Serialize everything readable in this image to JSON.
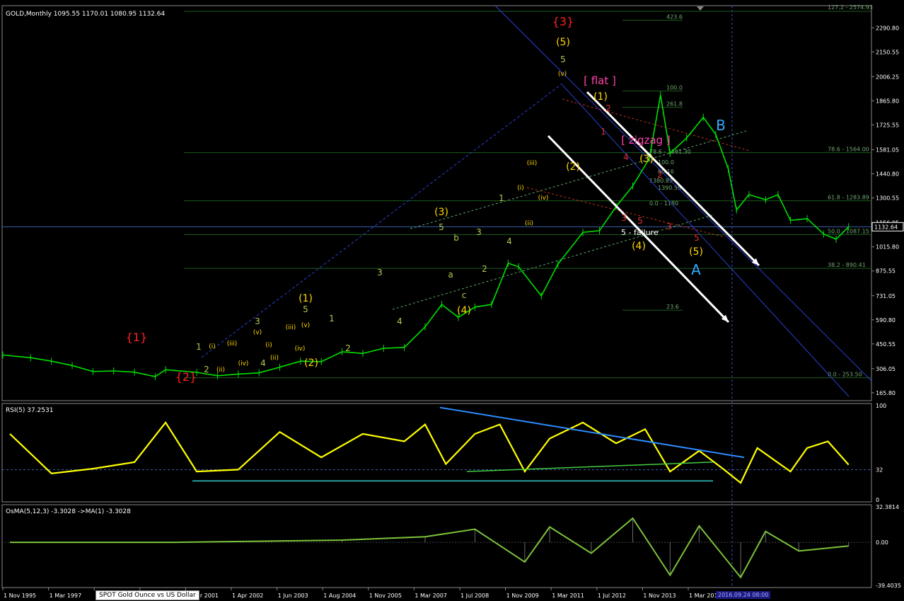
{
  "header": {
    "main": "GOLD,Monthly  1095.55 1170.01 1080.95 1132.64",
    "rsi": "RSI(5) 37.2531",
    "osma": "OsMA(5,12,3) -3.3028  ->MA(1) -3.3028"
  },
  "price_axis": [
    "2290.80",
    "2150.55",
    "2006.25",
    "1865.80",
    "1725.55",
    "1581.05",
    "1440.80",
    "1300.55",
    "1156.05",
    "1015.80",
    "875.55",
    "731.05",
    "590.80",
    "450.55",
    "306.05",
    "165.80"
  ],
  "current_price_label": "1132.64",
  "rsi_axis": [
    "100",
    "32",
    "0"
  ],
  "osma_axis": [
    "32.3814",
    "0.00",
    "-39.4035"
  ],
  "time_axis": [
    "1 Nov 1995",
    "1 Mar 1997",
    "1 Jul 1998",
    "1 Nov 1999",
    "1 Mar 2001",
    "1 Apr 2002",
    "1 Jun 2003",
    "1 Aug 2004",
    "1 Nov 2005",
    "1 Mar 2007",
    "1 Jul 2008",
    "1 Nov 2009",
    "1 Mar 2011",
    "1 Jul 2012",
    "1 Nov 2013",
    "1 Mar 2015"
  ],
  "bottom_tooltip": "SPOT Gold Ounce vs US Dollar",
  "bottom_cursor_date": "2016.09.24 08:00",
  "fib_levels": [
    {
      "label": "127.2 - 2574.93",
      "price": 2574.93
    },
    {
      "label": "423.6",
      "price": 2335
    },
    {
      "label": "100.0",
      "price": 1923
    },
    {
      "label": "261.8",
      "price": 1828
    },
    {
      "label": "78.6 - 1564.00",
      "price": 1564
    },
    {
      "label": "61.8 - 1283.89",
      "price": 1283.89
    },
    {
      "label": "50.0 - 1087.15",
      "price": 1087.15
    },
    {
      "label": "38.2 - 890.41",
      "price": 890.41
    },
    {
      "label": "23.6",
      "price": 647
    },
    {
      "label": "0.0 - 253.50",
      "price": 253.5
    }
  ],
  "small_fib_labels": [
    "78.6 - 1501.30",
    "100.0",
    "50.16",
    "1380.89",
    "0.0 - 1180",
    "1390.55"
  ],
  "colors": {
    "price": "#00e000",
    "rsi": "#ffff00",
    "osma": "#7cc23a",
    "grid": "#1e5c1e",
    "red_label": "#ff2020",
    "yellow_label": "#ffd700",
    "olive_label": "#b8c850",
    "magenta_label": "#ff44aa",
    "cyan_label": "#33aaff",
    "channel": "#2a3fd0"
  },
  "wave_labels": {
    "red_major": [
      "{1}",
      "{2}",
      "{3}"
    ],
    "yellow_intermediate": [
      "(1)",
      "(2)",
      "(3)",
      "(4)",
      "(5)",
      "(1)",
      "(2)",
      "(3)",
      "(4)",
      "(5)"
    ],
    "olive_minor": [
      "1",
      "2",
      "3",
      "4",
      "5",
      "1",
      "2",
      "3",
      "4",
      "5",
      "1",
      "2",
      "3",
      "4",
      "5",
      "a",
      "b",
      "c"
    ],
    "roman": [
      "(i)",
      "(ii)",
      "(iii)",
      "(iv)",
      "(v)",
      "(i)",
      "(ii)",
      "(iii)",
      "(iv)",
      "(v)",
      "(i)",
      "(ii)",
      "(iii)",
      "(iv)",
      "(v)"
    ],
    "pattern": [
      "[ flat ]",
      "[ zigzag ]"
    ],
    "correction": [
      "A",
      "B"
    ],
    "note": "5 - failure"
  },
  "chart_data": [
    {
      "type": "line",
      "title": "GOLD,Monthly",
      "series": [
        {
          "name": "GOLD",
          "values": [
            [
              1995.83,
              386
            ],
            [
              1996.5,
              370
            ],
            [
              1997.0,
              350
            ],
            [
              1997.5,
              325
            ],
            [
              1998.0,
              290
            ],
            [
              1998.5,
              293
            ],
            [
              1999.0,
              286
            ],
            [
              1999.5,
              260
            ],
            [
              1999.75,
              300
            ],
            [
              2000.5,
              285
            ],
            [
              2001.0,
              265
            ],
            [
              2001.5,
              275
            ],
            [
              2002.0,
              282
            ],
            [
              2002.5,
              315
            ],
            [
              2003.0,
              350
            ],
            [
              2003.5,
              347
            ],
            [
              2004.0,
              405
            ],
            [
              2004.5,
              395
            ],
            [
              2005.0,
              425
            ],
            [
              2005.5,
              430
            ],
            [
              2006.0,
              550
            ],
            [
              2006.4,
              680
            ],
            [
              2006.8,
              605
            ],
            [
              2007.2,
              665
            ],
            [
              2007.6,
              680
            ],
            [
              2008.0,
              920
            ],
            [
              2008.25,
              900
            ],
            [
              2008.8,
              730
            ],
            [
              2009.2,
              915
            ],
            [
              2009.8,
              1100
            ],
            [
              2010.2,
              1110
            ],
            [
              2010.6,
              1250
            ],
            [
              2011.0,
              1370
            ],
            [
              2011.4,
              1530
            ],
            [
              2011.67,
              1900
            ],
            [
              2011.9,
              1560
            ],
            [
              2012.3,
              1650
            ],
            [
              2012.7,
              1770
            ],
            [
              2013.0,
              1670
            ],
            [
              2013.3,
              1470
            ],
            [
              2013.5,
              1230
            ],
            [
              2013.8,
              1320
            ],
            [
              2014.2,
              1290
            ],
            [
              2014.5,
              1320
            ],
            [
              2014.8,
              1170
            ],
            [
              2015.2,
              1180
            ],
            [
              2015.6,
              1090
            ],
            [
              2015.9,
              1060
            ],
            [
              2016.2,
              1132.64
            ]
          ]
        }
      ],
      "ylim": [
        120,
        2420
      ],
      "xlim": [
        1995.83,
        2016.75
      ]
    },
    {
      "type": "line",
      "title": "RSI(5) 37.2531",
      "series": [
        {
          "name": "RSI(5)",
          "values": [
            [
              1996,
              70
            ],
            [
              1997,
              28
            ],
            [
              1998,
              33
            ],
            [
              1999,
              40
            ],
            [
              1999.75,
              82
            ],
            [
              2000.5,
              30
            ],
            [
              2001.5,
              32
            ],
            [
              2002.5,
              72
            ],
            [
              2003.5,
              45
            ],
            [
              2004.5,
              70
            ],
            [
              2005.5,
              62
            ],
            [
              2006,
              80
            ],
            [
              2006.5,
              38
            ],
            [
              2007.2,
              70
            ],
            [
              2007.8,
              80
            ],
            [
              2008.4,
              30
            ],
            [
              2009,
              65
            ],
            [
              2009.8,
              82
            ],
            [
              2010.6,
              60
            ],
            [
              2011.3,
              75
            ],
            [
              2011.9,
              30
            ],
            [
              2012.6,
              52
            ],
            [
              2013.2,
              32
            ],
            [
              2013.6,
              18
            ],
            [
              2014,
              55
            ],
            [
              2014.8,
              30
            ],
            [
              2015.2,
              55
            ],
            [
              2015.7,
              62
            ],
            [
              2016.2,
              37.25
            ]
          ]
        }
      ],
      "ylim": [
        0,
        100
      ]
    },
    {
      "type": "bar",
      "title": "OsMA(5,12,3)",
      "series": [
        {
          "name": "OsMA",
          "values": [
            [
              1996,
              0
            ],
            [
              2000,
              0
            ],
            [
              2004,
              2
            ],
            [
              2006,
              5
            ],
            [
              2007.2,
              12
            ],
            [
              2008.4,
              -18
            ],
            [
              2009,
              14
            ],
            [
              2010,
              -10
            ],
            [
              2011,
              22
            ],
            [
              2011.9,
              -30
            ],
            [
              2012.6,
              15
            ],
            [
              2013.6,
              -32
            ],
            [
              2014.2,
              10
            ],
            [
              2015,
              -8
            ],
            [
              2016.2,
              -3.3028
            ]
          ]
        }
      ],
      "ylim": [
        -39.4035,
        32.3814
      ]
    }
  ]
}
